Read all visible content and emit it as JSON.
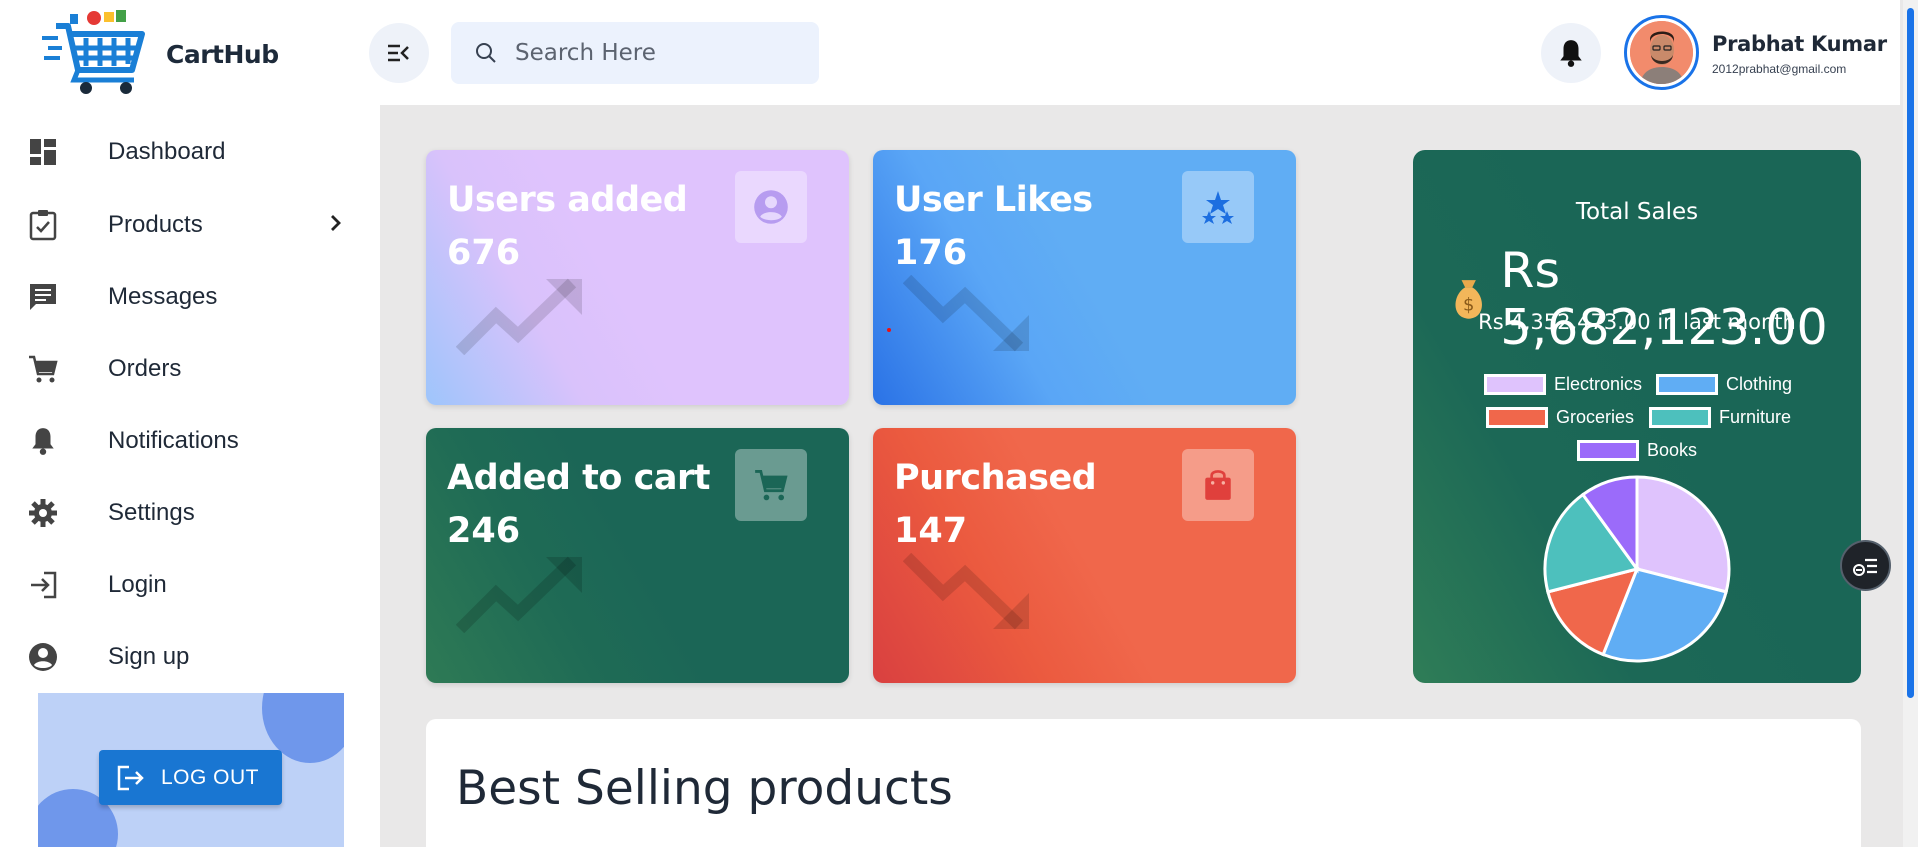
{
  "app": {
    "brand": "CartHub"
  },
  "header": {
    "search_placeholder": "Search Here",
    "user": {
      "name": "Prabhat Kumar",
      "email": "2012prabhat@gmail.com"
    }
  },
  "sidebar": {
    "items": [
      {
        "label": "Dashboard",
        "icon": "dashboard-icon"
      },
      {
        "label": "Products",
        "icon": "clipboard-check-icon",
        "has_submenu": true
      },
      {
        "label": "Messages",
        "icon": "message-icon"
      },
      {
        "label": "Orders",
        "icon": "cart-icon"
      },
      {
        "label": "Notifications",
        "icon": "bell-icon"
      },
      {
        "label": "Settings",
        "icon": "gear-icon"
      },
      {
        "label": "Login",
        "icon": "login-icon"
      },
      {
        "label": "Sign up",
        "icon": "account-circle-icon"
      }
    ],
    "logout_label": "LOG OUT"
  },
  "cards": [
    {
      "title": "Users added",
      "value": "676",
      "icon": "account-circle-icon",
      "trend": "up",
      "color": "#dfc3fd"
    },
    {
      "title": "User Likes",
      "value": "176",
      "icon": "stars-icon",
      "trend": "down",
      "color": "#60adf4"
    },
    {
      "title": "Added to cart",
      "value": "246",
      "icon": "cart-icon",
      "trend": "up",
      "color": "#1b6656"
    },
    {
      "title": "Purchased",
      "value": "147",
      "icon": "shopping-bag-icon",
      "trend": "down",
      "color": "#f0674b"
    }
  ],
  "sales": {
    "title": "Total Sales",
    "amount": "Rs 5,682,123.00",
    "last_month": "Rs 4,352,473.00 in last month"
  },
  "chart_data": {
    "type": "pie",
    "categories": [
      "Electronics",
      "Clothing",
      "Groceries",
      "Furniture",
      "Books"
    ],
    "values": [
      29,
      27,
      15,
      19,
      10
    ],
    "colors": [
      "#dfc3fd",
      "#60adf4",
      "#f0674b",
      "#4dc0bd",
      "#9b6bfa"
    ],
    "legend": "top"
  },
  "best_selling": {
    "title": "Best Selling products"
  }
}
